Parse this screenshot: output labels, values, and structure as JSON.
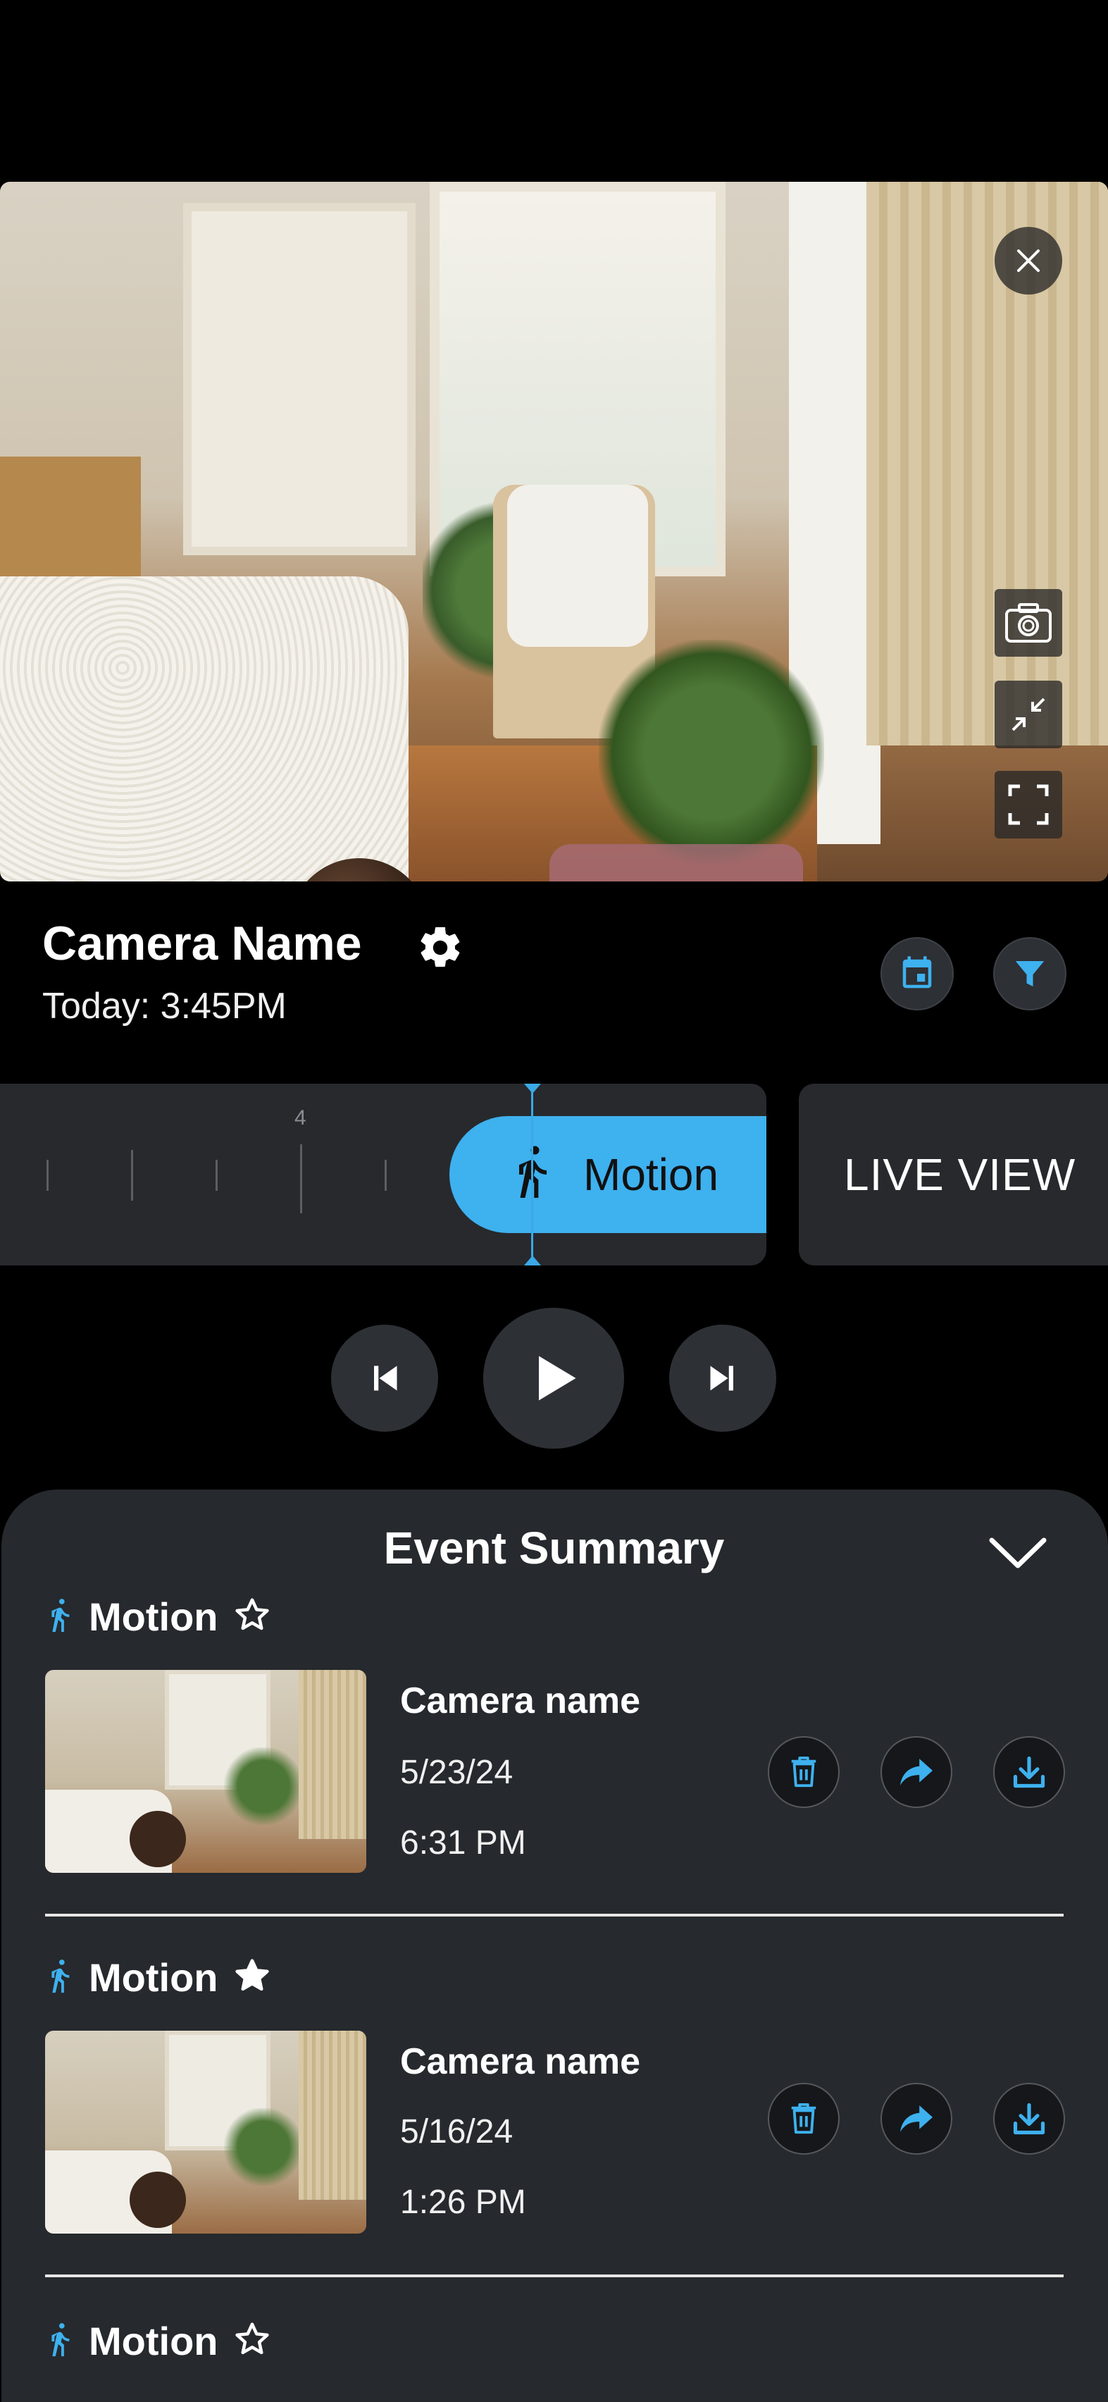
{
  "camera": {
    "name": "Camera Name",
    "timestamp": "Today: 3:45PM"
  },
  "timeline": {
    "tick_label": "4",
    "event_label": "Motion"
  },
  "live_view_label": "LIVE VIEW",
  "event_summary": {
    "title": "Event Summary",
    "events": [
      {
        "type": "Motion",
        "starred": false,
        "camera": "Camera name",
        "date": "5/23/24",
        "time": "6:31 PM"
      },
      {
        "type": "Motion",
        "starred": true,
        "camera": "Camera name",
        "date": "5/16/24",
        "time": "1:26 PM"
      },
      {
        "type": "Motion",
        "starred": false
      }
    ]
  },
  "colors": {
    "accent": "#3eb1ef",
    "panel": "#26292d",
    "background": "#000000"
  },
  "icons": [
    "close-icon",
    "camera-snapshot-icon",
    "minimize-icon",
    "fullscreen-icon",
    "gear-icon",
    "calendar-icon",
    "filter-icon",
    "running-person-icon",
    "skip-previous-icon",
    "play-icon",
    "skip-next-icon",
    "chevron-down-icon",
    "star-outline-icon",
    "star-filled-icon",
    "trash-icon",
    "share-icon",
    "download-icon"
  ]
}
